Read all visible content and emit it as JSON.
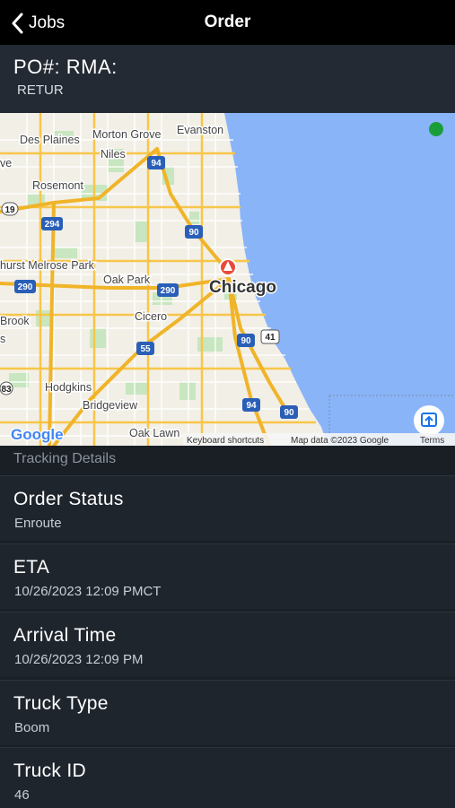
{
  "nav": {
    "back_label": "Jobs",
    "title": "Order"
  },
  "order": {
    "po_line": "PO#: RMA:",
    "sub_line": "RETUR"
  },
  "map": {
    "labels": {
      "des_plaines": "Des Plaines",
      "morton_grove": "Morton Grove",
      "evanston": "Evanston",
      "niles": "Niles",
      "rosemont": "Rosemont",
      "melrose_park": "hurst Melrose Park",
      "oak_park": "Oak Park",
      "chicago": "Chicago",
      "cicero": "Cicero",
      "brook": "Brook",
      "hodgkins": "Hodgkins",
      "bridgeview": "Bridgeview",
      "oak_lawn": "Oak Lawn",
      "ve": "ve",
      "s": "s"
    },
    "shields": {
      "i94": "94",
      "i294": "294",
      "i90": "90",
      "i290": "290",
      "i55": "55",
      "us41": "41",
      "i94b": "94",
      "i90b": "90",
      "r19": "19",
      "r83": "83"
    },
    "attribution": {
      "google": "Google",
      "shortcuts": "Keyboard shortcuts",
      "map_data": "Map data ©2023 Google",
      "terms": "Terms"
    }
  },
  "tracking": {
    "section_label": "Tracking Details",
    "rows": [
      {
        "title": "Order Status",
        "value": "Enroute"
      },
      {
        "title": "ETA",
        "value": "10/26/2023 12:09 PMCT"
      },
      {
        "title": "Arrival Time",
        "value": "10/26/2023 12:09 PM"
      },
      {
        "title": "Truck Type",
        "value": "Boom"
      },
      {
        "title": "Truck ID",
        "value": "46"
      }
    ]
  },
  "colors": {
    "nav_bg": "#000000",
    "lake": "#8ab4f8",
    "land": "#f2efe6",
    "highway": "#f7c64a",
    "park": "#c8e6c0",
    "marker": "#e84a3a",
    "status_dot": "#1a9e3a"
  }
}
